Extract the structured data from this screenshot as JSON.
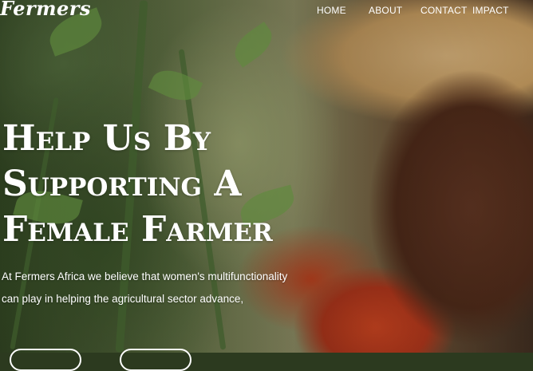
{
  "brand": {
    "logo_text": "Fermers"
  },
  "nav": {
    "items": [
      {
        "label": "HOME"
      },
      {
        "label": "ABOUT"
      },
      {
        "label": "CONTACT"
      },
      {
        "label": "IMPACT"
      }
    ]
  },
  "hero": {
    "headline_lines": [
      "Help Us By",
      "Supporting A",
      "Female Farmer"
    ],
    "subtext_lines": [
      "At Fermers Africa we believe that women's multifunctionality",
      "can play in helping the agricultural sector advance,"
    ],
    "buttons": [
      "",
      ""
    ]
  },
  "colors": {
    "text": "#ffffff"
  }
}
